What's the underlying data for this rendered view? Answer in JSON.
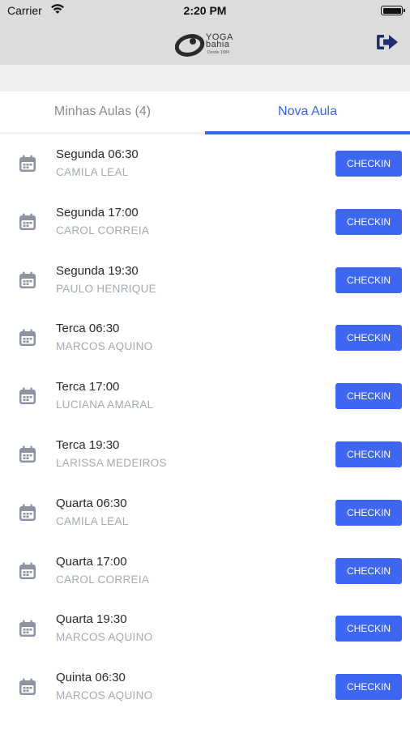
{
  "status_bar": {
    "carrier": "Carrier",
    "time": "2:20 PM"
  },
  "header": {
    "logo_text": "YOGA BAHIA",
    "logo_word_1": "YOGA",
    "logo_word_2": "bahia",
    "logo_tagline": "Desde 1984",
    "logout_icon": "logout-icon"
  },
  "tabs": [
    {
      "label": "Minhas Aulas (4)",
      "active": false
    },
    {
      "label": "Nova Aula",
      "active": true
    }
  ],
  "colors": {
    "accent": "#3d66f3",
    "header_bg": "#dcdcdc",
    "muted_text": "#a5a9b4",
    "icon": "#8d93a3"
  },
  "classes": [
    {
      "title": "Segunda 06:30",
      "teacher": "CAMILA LEAL",
      "action": "CHECKIN"
    },
    {
      "title": "Segunda 17:00",
      "teacher": "CAROL CORREIA",
      "action": "CHECKIN"
    },
    {
      "title": "Segunda 19:30",
      "teacher": "PAULO HENRIQUE",
      "action": "CHECKIN"
    },
    {
      "title": "Terca 06:30",
      "teacher": "MARCOS AQUINO",
      "action": "CHECKIN"
    },
    {
      "title": "Terca 17:00",
      "teacher": "LUCIANA AMARAL",
      "action": "CHECKIN"
    },
    {
      "title": "Terca 19:30",
      "teacher": "LARISSA MEDEIROS",
      "action": "CHECKIN"
    },
    {
      "title": "Quarta 06:30",
      "teacher": "CAMILA LEAL",
      "action": "CHECKIN"
    },
    {
      "title": "Quarta 17:00",
      "teacher": "CAROL CORREIA",
      "action": "CHECKIN"
    },
    {
      "title": "Quarta 19:30",
      "teacher": "MARCOS AQUINO",
      "action": "CHECKIN"
    },
    {
      "title": "Quinta 06:30",
      "teacher": "MARCOS AQUINO",
      "action": "CHECKIN"
    }
  ]
}
